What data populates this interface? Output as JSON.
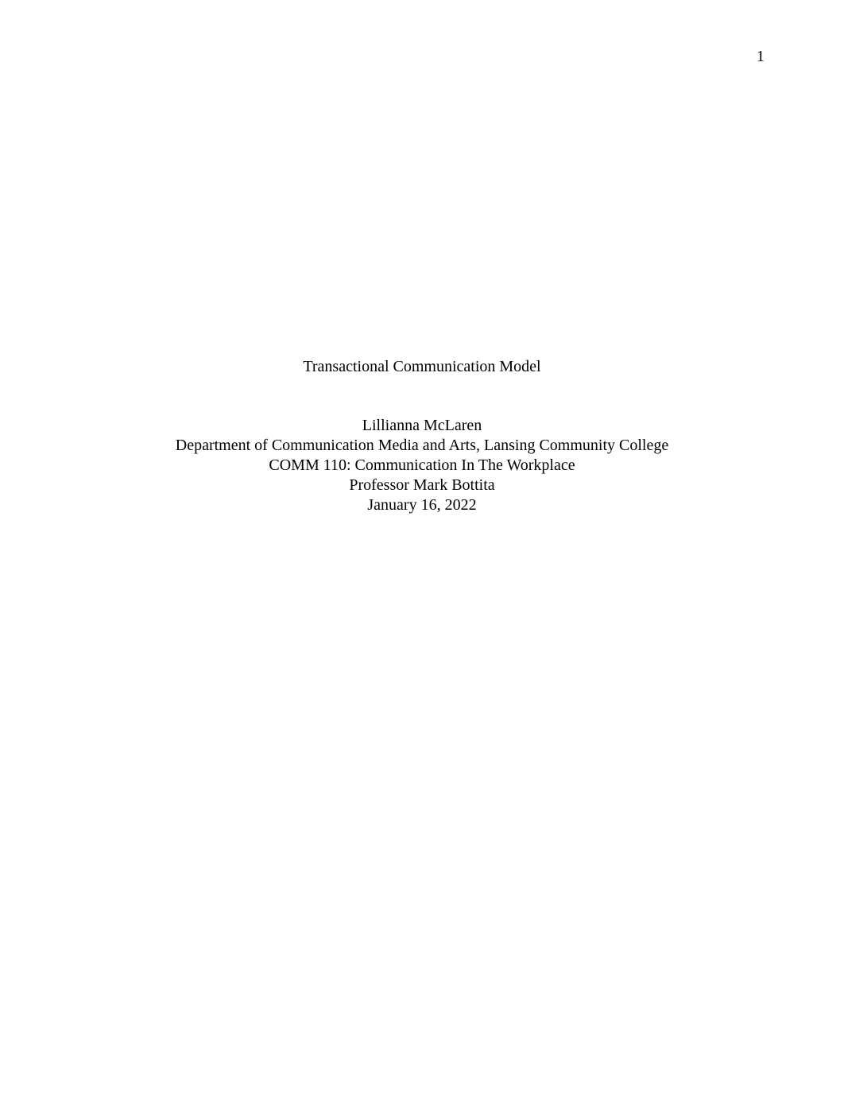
{
  "page_number": "1",
  "title": "Transactional Communication Model",
  "author": "Lillianna McLaren",
  "department": "Department of Communication Media and Arts, Lansing Community College",
  "course": "COMM 110: Communication In The Workplace",
  "professor": "Professor Mark Bottita",
  "date": "January 16, 2022"
}
